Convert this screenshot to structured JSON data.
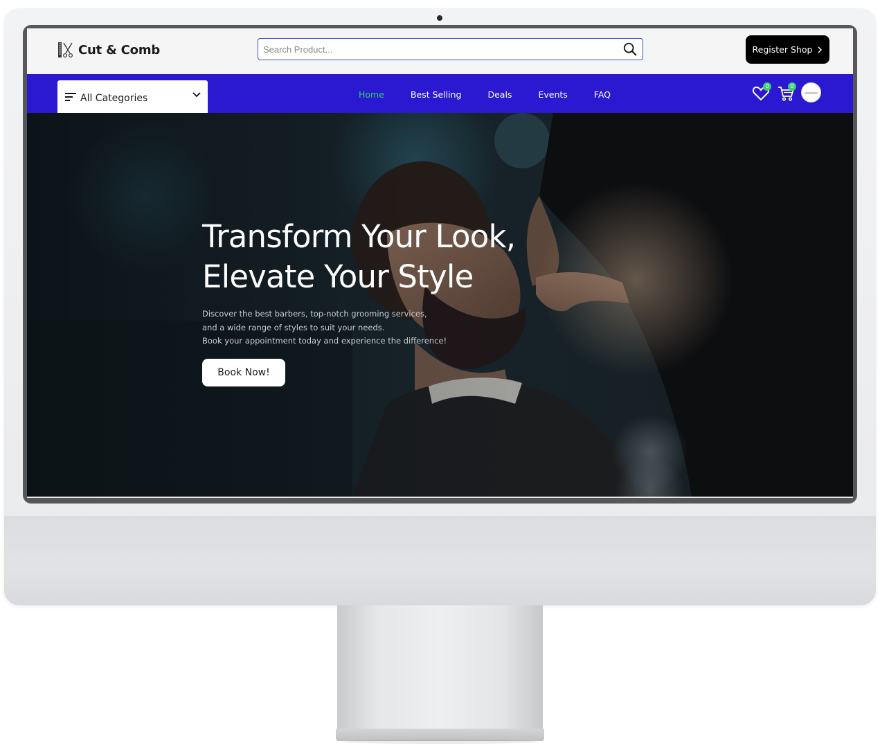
{
  "brand": {
    "name": "Cut & Comb",
    "logo_icon": "scissors-comb-icon"
  },
  "search": {
    "placeholder": "Search Product...",
    "value": ""
  },
  "header": {
    "register_label": "Register Shop"
  },
  "nav": {
    "categories_label": "All Categories",
    "links": [
      {
        "label": "Home",
        "active": true
      },
      {
        "label": "Best Selling",
        "active": false
      },
      {
        "label": "Deals",
        "active": false
      },
      {
        "label": "Events",
        "active": false
      },
      {
        "label": "FAQ",
        "active": false
      }
    ],
    "wishlist_count": "0",
    "cart_count": "0"
  },
  "hero": {
    "title_line1": "Transform Your Look,",
    "title_line2": "Elevate Your Style",
    "sub_line1": "Discover the best barbers, top-notch grooming services,",
    "sub_line2": "and a wide range of styles to suit your needs.",
    "sub_line3": "Book your appointment today and experience the difference!",
    "cta_label": "Book Now!"
  },
  "colors": {
    "nav_bg": "#2b18d1",
    "active_link": "#25d366",
    "badge": "#3bd16f",
    "register_bg": "#000000",
    "search_border": "#3b4cca"
  }
}
